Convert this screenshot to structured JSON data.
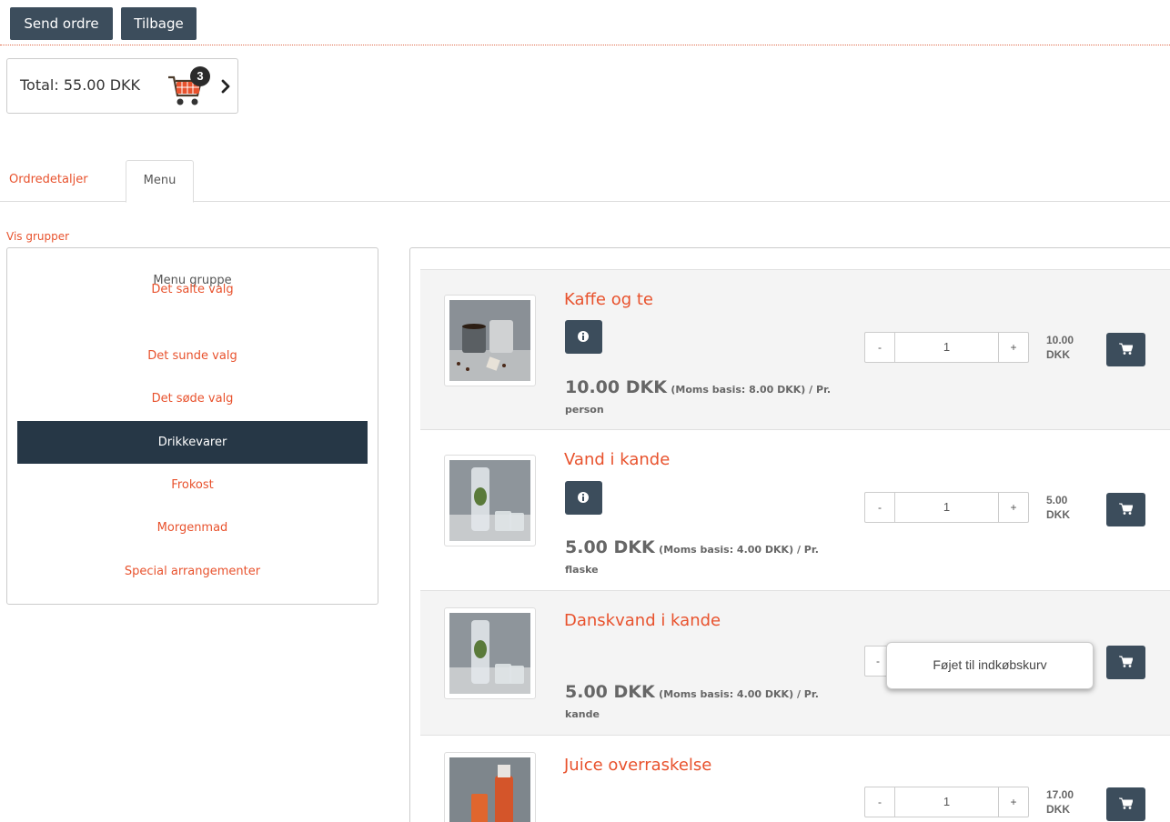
{
  "toolbar": {
    "send_label": "Send ordre",
    "back_label": "Tilbage"
  },
  "cart": {
    "total_label": "Total: 55.00 DKK",
    "item_count": "3"
  },
  "tabs": [
    {
      "label": "Ordredetaljer",
      "active": false
    },
    {
      "label": "Menu",
      "active": true
    }
  ],
  "sidebar": {
    "toggle_label": "Vis grupper",
    "title": "Menu gruppe",
    "items": [
      {
        "label": "Det salte valg",
        "active": false
      },
      {
        "label": "Det sunde valg",
        "active": false
      },
      {
        "label": "Det søde valg",
        "active": false
      },
      {
        "label": "Drikkevarer",
        "active": true
      },
      {
        "label": "Frokost",
        "active": false
      },
      {
        "label": "Morgenmad",
        "active": false
      },
      {
        "label": "Special arrangementer",
        "active": false
      }
    ]
  },
  "products": [
    {
      "name": "Kaffe og te",
      "price": "10.00 DKK",
      "vat": "(Moms basis: 8.00 DKK) / Pr.",
      "unit": "person",
      "qty": "1",
      "line_total_amount": "10.00",
      "line_total_currency": "DKK",
      "has_info": true
    },
    {
      "name": "Vand i kande",
      "price": "5.00 DKK",
      "vat": "(Moms basis: 4.00 DKK) / Pr.",
      "unit": "flaske",
      "qty": "1",
      "line_total_amount": "5.00",
      "line_total_currency": "DKK",
      "has_info": true
    },
    {
      "name": "Danskvand i kande",
      "price": "5.00 DKK",
      "vat": "(Moms basis: 4.00 DKK) / Pr.",
      "unit": "kande",
      "qty": "",
      "line_total_amount": "",
      "line_total_currency": "",
      "has_info": false
    },
    {
      "name": "Juice overraskelse",
      "price": "",
      "vat": "",
      "unit": "",
      "qty": "1",
      "line_total_amount": "17.00",
      "line_total_currency": "DKK",
      "has_info": false
    }
  ],
  "qty_controls": {
    "minus": "-",
    "plus": "+"
  },
  "toast": {
    "message": "Føjet til indkøbskurv"
  },
  "colors": {
    "accent": "#e8522d",
    "button_dark": "#3c4d5c",
    "active_group": "#263746"
  }
}
